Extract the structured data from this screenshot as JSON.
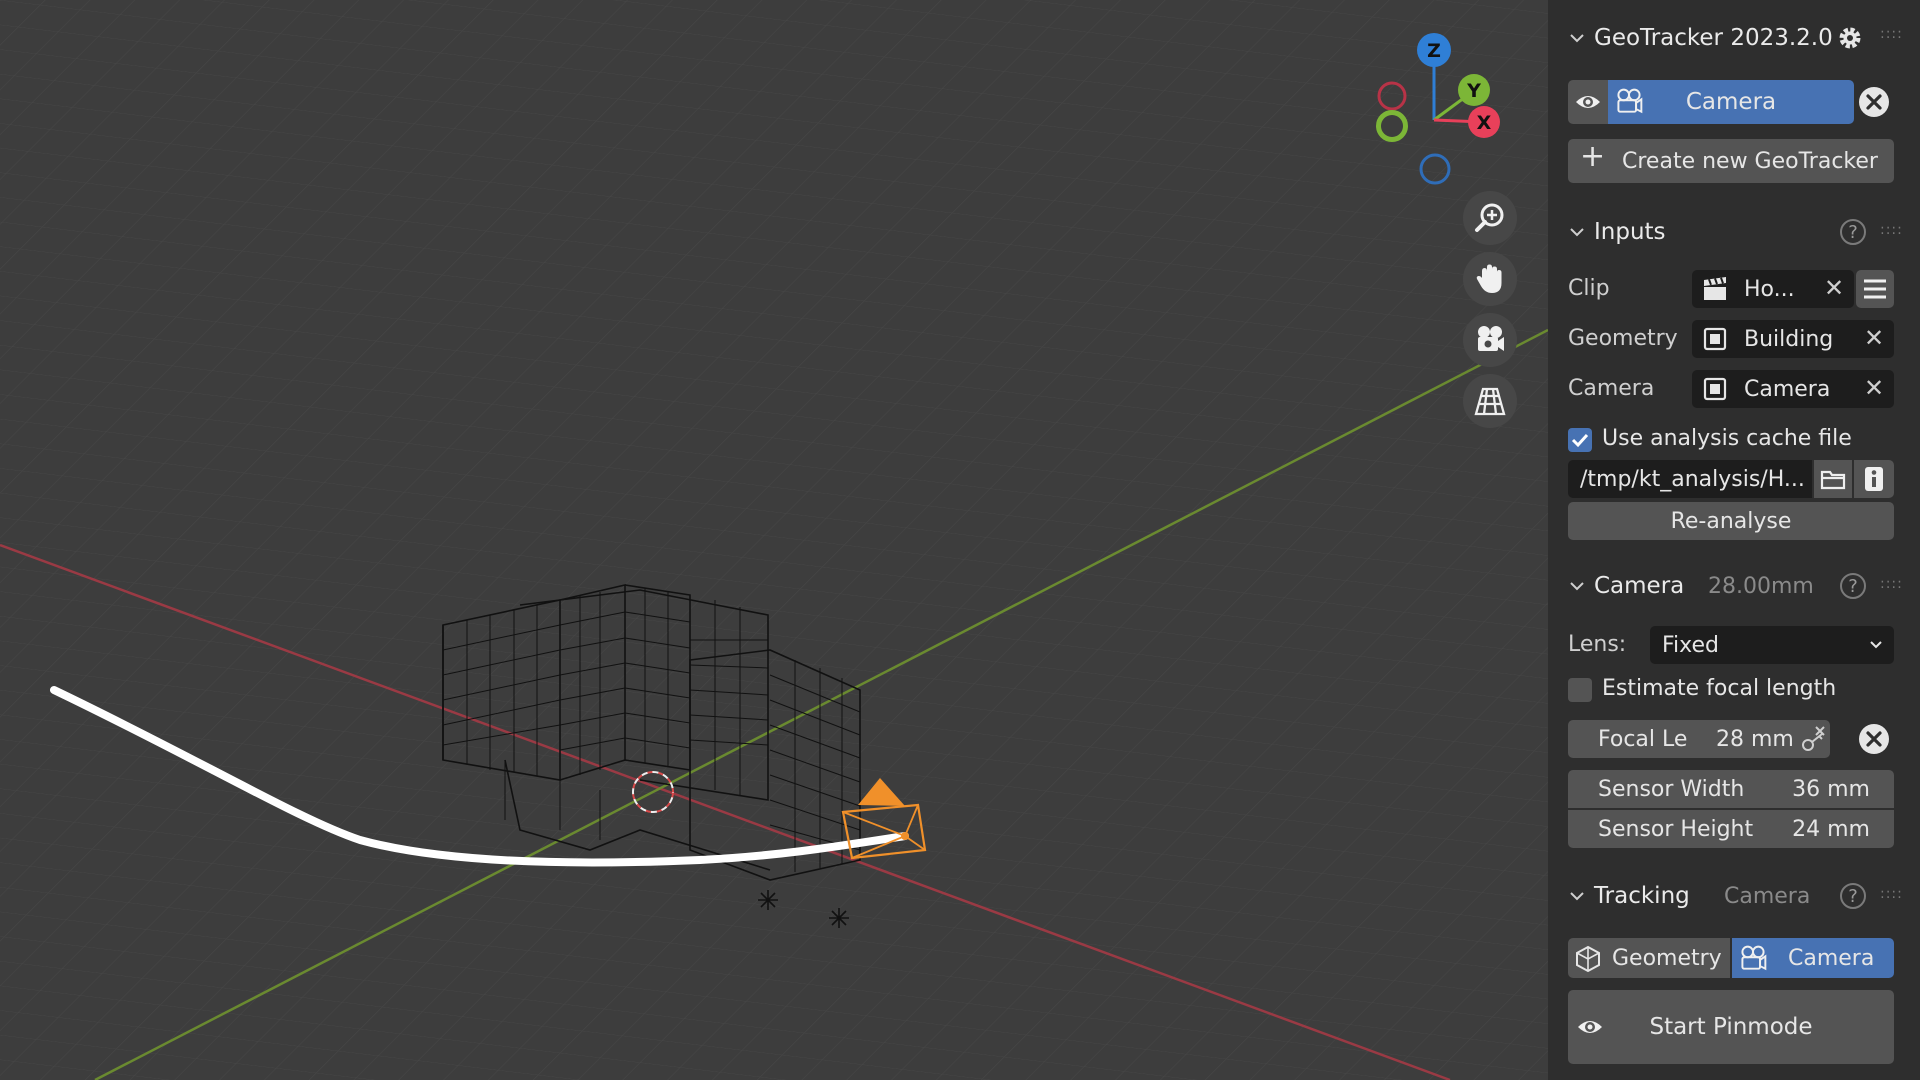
{
  "viewport": {
    "gizmo": {
      "z": "Z",
      "y": "Y",
      "x": "X"
    },
    "nav_icons": [
      "zoom-icon",
      "hand-pan-icon",
      "camera-view-icon",
      "grid-perspective-icon"
    ]
  },
  "panel": {
    "header": {
      "title": "GeoTracker 2023.2.0"
    },
    "target": {
      "label": "Camera"
    },
    "create_button": "Create new GeoTracker",
    "inputs": {
      "title": "Inputs",
      "clip": {
        "label": "Clip",
        "value": "Ho..."
      },
      "geometry": {
        "label": "Geometry",
        "value": "Building"
      },
      "camera": {
        "label": "Camera",
        "value": "Camera"
      },
      "cache_checkbox": {
        "label": "Use analysis cache file",
        "checked": true
      },
      "cache_path": "/tmp/kt_analysis/H...",
      "reanalyse": "Re-analyse"
    },
    "camera": {
      "title": "Camera",
      "subtitle": "28.00mm",
      "lens_label": "Lens:",
      "lens_value": "Fixed",
      "estimate_checkbox": {
        "label": "Estimate focal length",
        "checked": false
      },
      "focal": {
        "label": "Focal Le",
        "value": "28 mm"
      },
      "sensor_width": {
        "label": "Sensor Width",
        "value": "36 mm"
      },
      "sensor_height": {
        "label": "Sensor Height",
        "value": "24 mm"
      }
    },
    "tracking": {
      "title": "Tracking",
      "subtitle": "Camera",
      "geometry_btn": "Geometry",
      "camera_btn": "Camera",
      "pinmode_btn": "Start Pinmode"
    }
  },
  "colors": {
    "accent_blue": "#4772b3",
    "axis_x": "#e8405a",
    "axis_y": "#7cb637",
    "axis_z": "#2f7fd6",
    "camera_orange": "#f0902a"
  }
}
